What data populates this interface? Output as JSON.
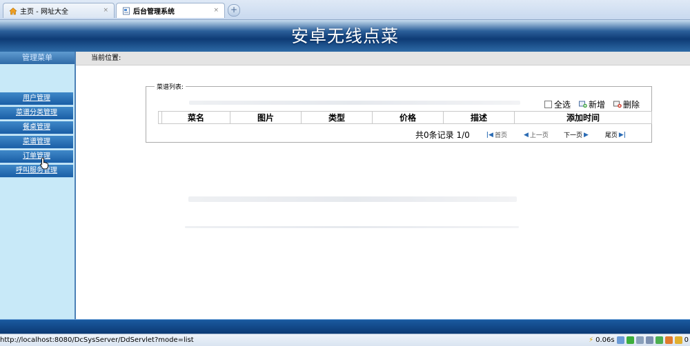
{
  "browser": {
    "tabs": [
      {
        "label": "主页 - 网址大全",
        "active": false
      },
      {
        "label": "后台管理系统",
        "active": true
      }
    ],
    "close_glyph": "×",
    "new_tab_glyph": "+"
  },
  "header": {
    "title": "安卓无线点菜"
  },
  "sidebar": {
    "title": "管理菜单",
    "items": [
      {
        "label": "用户管理"
      },
      {
        "label": "菜谱分类管理"
      },
      {
        "label": "餐桌管理"
      },
      {
        "label": "菜谱管理"
      },
      {
        "label": "订单管理"
      },
      {
        "label": "呼叫服务管理"
      }
    ]
  },
  "main": {
    "location_label": "当前位置:",
    "panel_legend": "菜谱列表:",
    "actions": {
      "select_all": "全选",
      "add": "新增",
      "delete": "删除"
    },
    "table": {
      "columns": [
        "菜名",
        "图片",
        "类型",
        "价格",
        "描述",
        "添加时间"
      ]
    },
    "pager": {
      "summary": "共0条记录 1/0",
      "first": "首页",
      "prev": "上一页",
      "next": "下一页",
      "last": "尾页"
    }
  },
  "statusbar": {
    "url": "http://localhost:8080/DcSysServer/DdServlet?mode=list",
    "timing": "0.06s",
    "trailing": "0"
  },
  "colors": {
    "header_dark": "#0e3b75",
    "sidebar_bg": "#c8e9f8",
    "menu_item": "#1a5ea6"
  }
}
